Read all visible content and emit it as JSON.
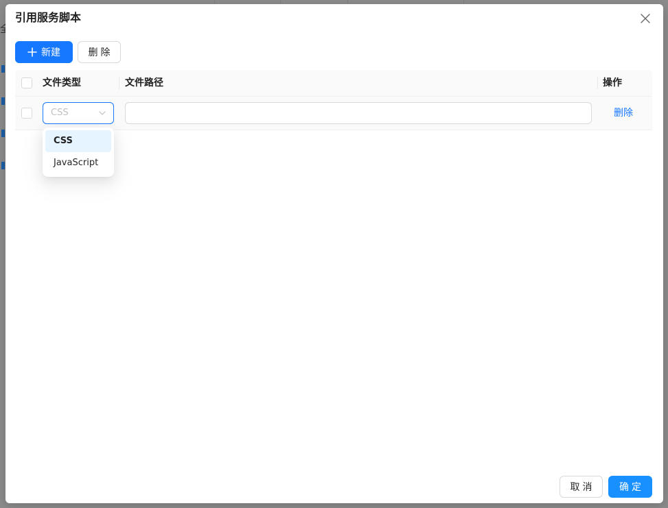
{
  "background": {
    "partial_char": "全"
  },
  "modal": {
    "title": "引用服务脚本"
  },
  "toolbar": {
    "new_label": "新建",
    "delete_label": "删除"
  },
  "table": {
    "columns": [
      "文件类型",
      "文件路径",
      "操作"
    ],
    "rows": [
      {
        "type_placeholder": "CSS",
        "path_value": "",
        "action_label": "删除"
      }
    ]
  },
  "dropdown": {
    "options": [
      "CSS",
      "JavaScript"
    ],
    "selected": "CSS"
  },
  "footer": {
    "cancel_label": "取消",
    "ok_label": "确定"
  },
  "colors": {
    "primary": "#1677ff",
    "ok": "#1890ff",
    "selected_option_bg": "#e6f4ff",
    "overlay": "#8c8c8c"
  },
  "icons": {
    "close": "close-icon",
    "plus": "plus-icon",
    "arrow": "chevron-down-icon"
  }
}
